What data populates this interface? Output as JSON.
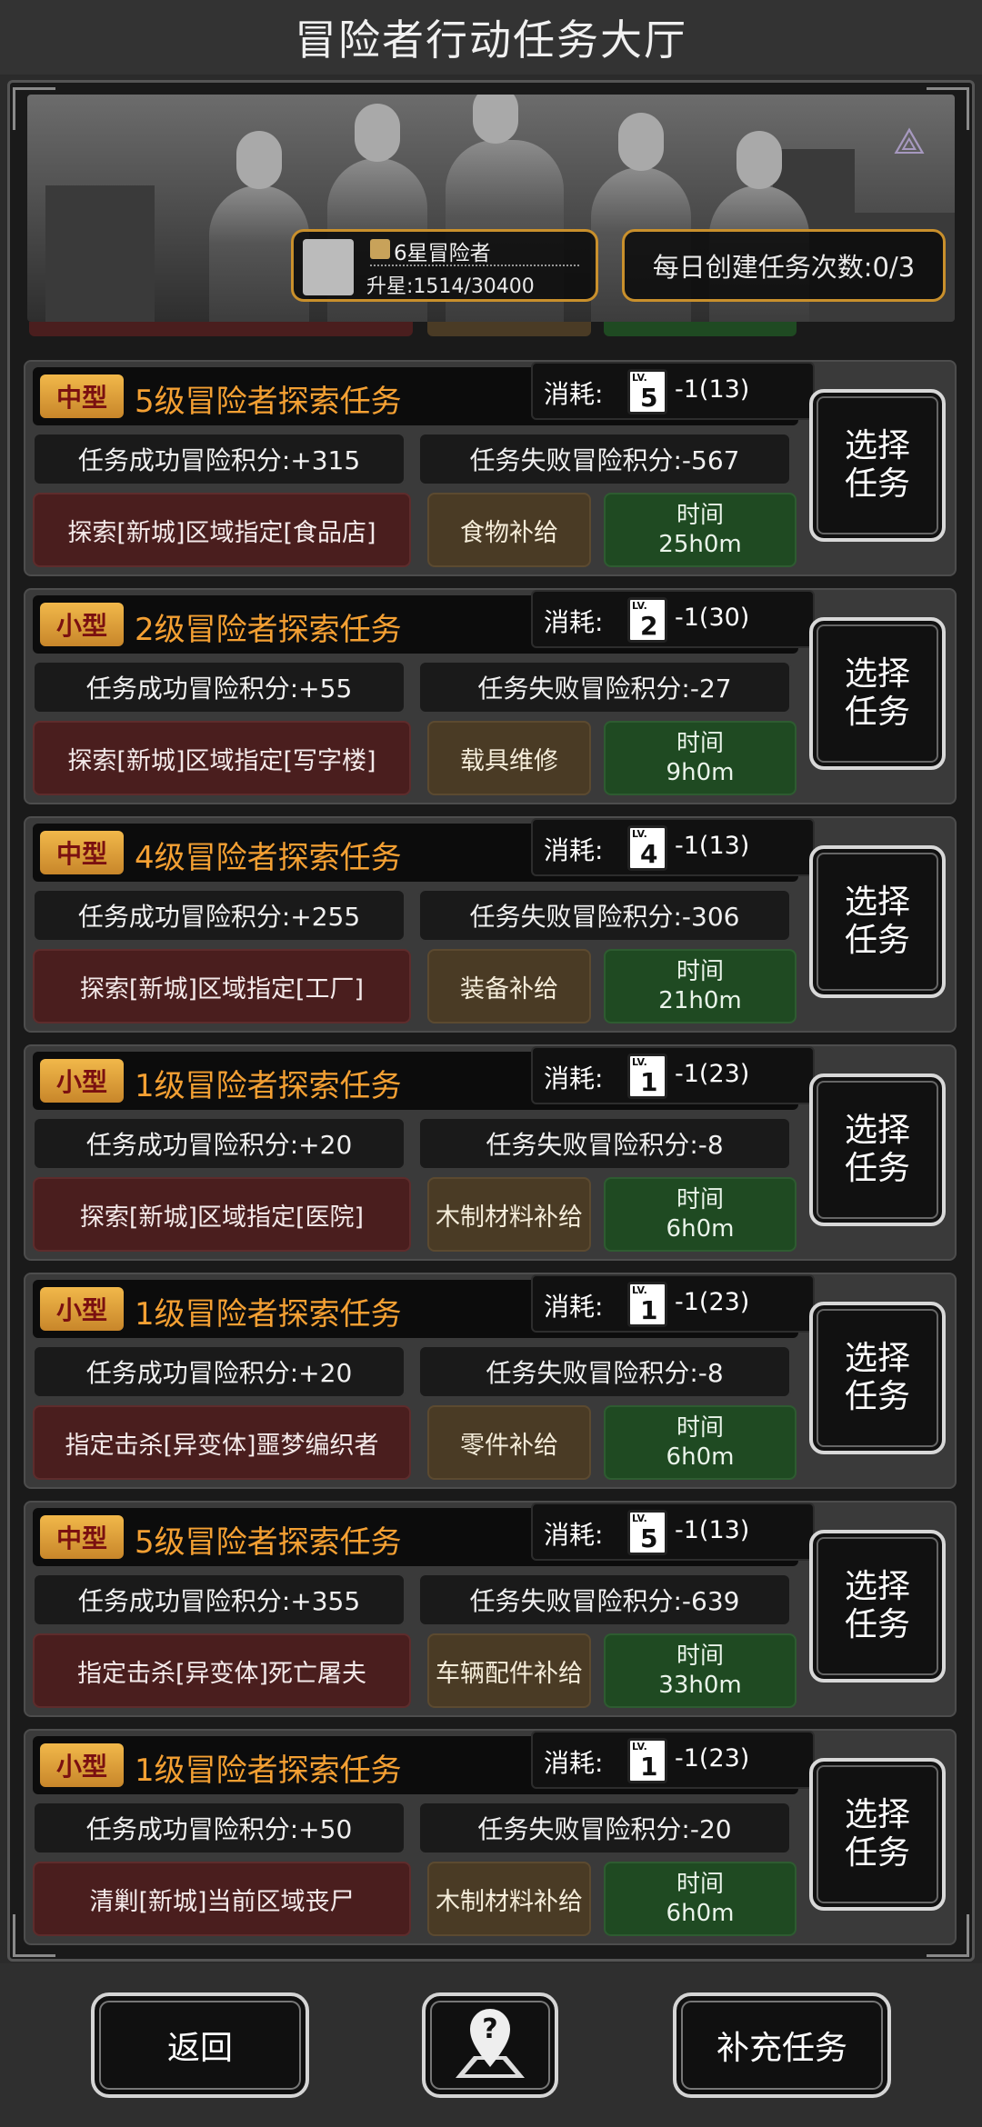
{
  "title": "冒险者行动任务大厅",
  "rank": {
    "title": "6星冒险者",
    "progress": "升星:1514/30400"
  },
  "daily": "每日创建任务次数:0/3",
  "cost_label": "消耗:",
  "lv_label": "LV.",
  "select_label": [
    "选择",
    "任务"
  ],
  "time_label": "时间",
  "tasks": [
    {
      "size": "中型",
      "name": "5级冒险者探索任务",
      "card_level": "5",
      "cost": "-1(13)",
      "success": "任务成功冒险积分:+315",
      "fail": "任务失败冒险积分:-567",
      "target": "探索[新城]区域指定[食品店]",
      "reward": "食物补给",
      "duration": "25h0m"
    },
    {
      "size": "小型",
      "name": "2级冒险者探索任务",
      "card_level": "2",
      "cost": "-1(30)",
      "success": "任务成功冒险积分:+55",
      "fail": "任务失败冒险积分:-27",
      "target": "探索[新城]区域指定[写字楼]",
      "reward": "载具维修",
      "duration": "9h0m"
    },
    {
      "size": "中型",
      "name": "4级冒险者探索任务",
      "card_level": "4",
      "cost": "-1(13)",
      "success": "任务成功冒险积分:+255",
      "fail": "任务失败冒险积分:-306",
      "target": "探索[新城]区域指定[工厂]",
      "reward": "装备补给",
      "duration": "21h0m"
    },
    {
      "size": "小型",
      "name": "1级冒险者探索任务",
      "card_level": "1",
      "cost": "-1(23)",
      "success": "任务成功冒险积分:+20",
      "fail": "任务失败冒险积分:-8",
      "target": "探索[新城]区域指定[医院]",
      "reward": "木制材料补给",
      "duration": "6h0m"
    },
    {
      "size": "小型",
      "name": "1级冒险者探索任务",
      "card_level": "1",
      "cost": "-1(23)",
      "success": "任务成功冒险积分:+20",
      "fail": "任务失败冒险积分:-8",
      "target": "指定击杀[异变体]噩梦编织者",
      "reward": "零件补给",
      "duration": "6h0m"
    },
    {
      "size": "中型",
      "name": "5级冒险者探索任务",
      "card_level": "5",
      "cost": "-1(13)",
      "success": "任务成功冒险积分:+355",
      "fail": "任务失败冒险积分:-639",
      "target": "指定击杀[异变体]死亡屠夫",
      "reward": "车辆配件补给",
      "duration": "33h0m"
    },
    {
      "size": "小型",
      "name": "1级冒险者探索任务",
      "card_level": "1",
      "cost": "-1(23)",
      "success": "任务成功冒险积分:+50",
      "fail": "任务失败冒险积分:-20",
      "target": "清剿[新城]当前区域丧尸",
      "reward": "木制材料补给",
      "duration": "6h0m"
    }
  ],
  "buttons": {
    "back": "返回",
    "more": "补充任务"
  },
  "icons": {
    "help": "help-map-icon",
    "emblem": "triangle-emblem-icon"
  },
  "colors": {
    "task_name": "#f4a033",
    "target_bg": "#4a1e1e",
    "reward_bg": "#4a3b25",
    "time_bg": "#1f4a22",
    "tag_gold": "#e0a23c"
  }
}
